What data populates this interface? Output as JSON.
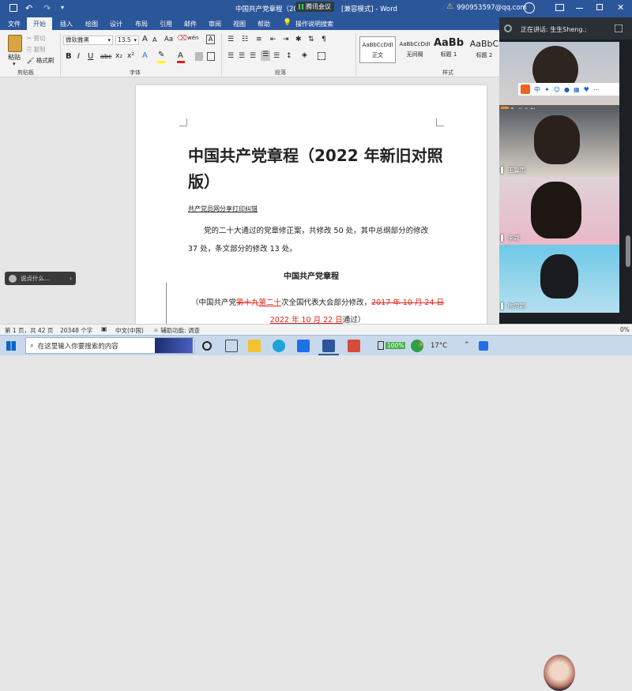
{
  "titlebar": {
    "doc_title": "中国共产党章程（2022",
    "meeting_badge": "腾讯会议",
    "mode": "[兼容模式] - Word",
    "account": "990953597@qq.com"
  },
  "tabs": [
    {
      "label": "文件"
    },
    {
      "label": "开始"
    },
    {
      "label": "插入"
    },
    {
      "label": "绘图"
    },
    {
      "label": "设计"
    },
    {
      "label": "布局"
    },
    {
      "label": "引用"
    },
    {
      "label": "邮件"
    },
    {
      "label": "审阅"
    },
    {
      "label": "视图"
    },
    {
      "label": "帮助"
    }
  ],
  "tell_me": "操作说明搜索",
  "clipboard": {
    "paste": "粘贴",
    "cut": "剪切",
    "copy": "复制",
    "format_painter": "格式刷",
    "label": "剪贴板"
  },
  "font": {
    "name": "微软雅黑",
    "size": "13.5",
    "grow": "A",
    "shrink": "A",
    "aa": "Aa",
    "wen": "wén",
    "a_box": "A",
    "bold": "B",
    "italic": "I",
    "underline": "U",
    "strike": "abc",
    "sub": "x₂",
    "sup": "x²",
    "label": "字体"
  },
  "paragraph": {
    "label": "段落"
  },
  "styles": {
    "items": [
      {
        "preview": "AaBbCcDdI",
        "name": "正文"
      },
      {
        "preview": "AaBbCcDdI",
        "name": "无间隔"
      },
      {
        "preview": "AaBb",
        "name": "标题 1"
      },
      {
        "preview": "AaBbC",
        "name": "标题 2"
      }
    ],
    "label": "样式"
  },
  "document": {
    "title": "中国共产党章程（2022 年新旧对照版）",
    "source": "共产党员网分享打印纠错",
    "intro": "党的二十大通过的党章修正案，共修改 50 处，其中总纲部分的修改 37 处，条文部分的修改 13 处。",
    "heading": "中国共产党章程",
    "rev_prefix": "（中国共产党",
    "rev_del1": "第十九",
    "rev_ins1": "第二十",
    "rev_mid": "次全国代表大会部分修改，",
    "rev_del2": "2017 年 10 月 24 日",
    "rev_ins2": "2022 年 10 月 22 日",
    "rev_suffix": "通过）"
  },
  "chat_bubble": "说点什么...",
  "statusbar": {
    "page": "第 1 页，共 42 页",
    "words": "20348 个字",
    "lang": "中文(中国)",
    "accessibility": "辅助功能: 调查",
    "zoom": "0%"
  },
  "meeting": {
    "speaking": "正在讲话: 生生Sheng.;",
    "participants": [
      {
        "name": "生生Sheng."
      },
      {
        "name": "王馨雨"
      },
      {
        "name": "李颖"
      },
      {
        "name": "陶思颖"
      }
    ],
    "ime": "中"
  },
  "taskbar": {
    "search": "在这里输入你要搜索的内容",
    "battery": "100%",
    "weather": "17°C"
  },
  "colors": {
    "word_blue": "#2b579a",
    "deleted": "#d9261c",
    "inserted": "#d9261c"
  }
}
